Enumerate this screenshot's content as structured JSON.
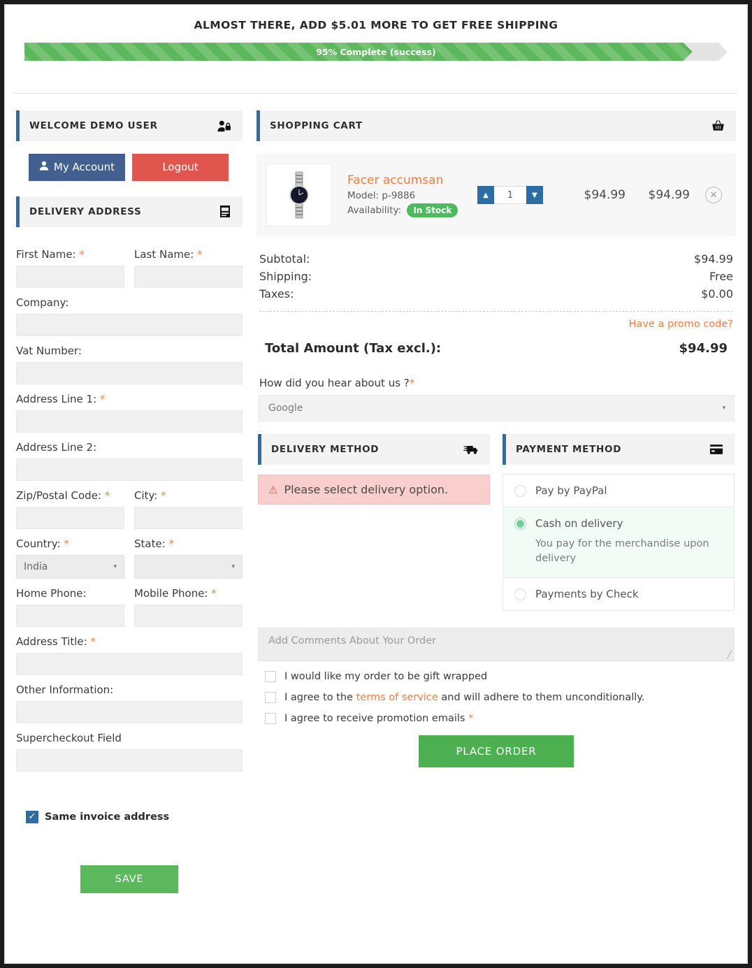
{
  "banner": {
    "title": "ALMOST THERE, ADD $5.01 MORE TO GET FREE SHIPPING",
    "progress_label": "95% Complete (success)",
    "progress_percent": 95,
    "fill_color": "#5cb85c",
    "track_color": "#e4e4e4"
  },
  "sidebar": {
    "welcome": {
      "title": "WELCOME DEMO USER",
      "icon": "user-lock-icon"
    },
    "account_button": "My Account",
    "logout_button": "Logout",
    "delivery_address": {
      "title": "DELIVERY ADDRESS",
      "icon": "address-card-icon"
    },
    "fields": {
      "first_name": {
        "label": "First Name:",
        "required": true,
        "value": ""
      },
      "last_name": {
        "label": "Last Name:",
        "required": true,
        "value": ""
      },
      "company": {
        "label": "Company:",
        "required": false,
        "value": ""
      },
      "vat_number": {
        "label": "Vat Number:",
        "required": false,
        "value": ""
      },
      "address1": {
        "label": "Address Line 1:",
        "required": true,
        "value": ""
      },
      "address2": {
        "label": "Address Line 2:",
        "required": false,
        "value": ""
      },
      "zip": {
        "label": "Zip/Postal Code:",
        "required": true,
        "value": ""
      },
      "city": {
        "label": "City:",
        "required": true,
        "value": ""
      },
      "country": {
        "label": "Country:",
        "required": true,
        "value": "India"
      },
      "state": {
        "label": "State:",
        "required": true,
        "value": ""
      },
      "home_phone": {
        "label": "Home Phone:",
        "required": false,
        "value": ""
      },
      "mobile_phone": {
        "label": "Mobile Phone:",
        "required": true,
        "value": ""
      },
      "address_title": {
        "label": "Address Title:",
        "required": true,
        "value": ""
      },
      "other_info": {
        "label": "Other Information:",
        "required": false,
        "value": ""
      },
      "supercheckout": {
        "label": "Supercheckout Field",
        "required": false,
        "value": ""
      }
    },
    "same_invoice": {
      "label": "Same invoice address",
      "checked": true,
      "check_glyph": "✓"
    },
    "save_button": "SAVE"
  },
  "cart": {
    "title": "SHOPPING CART",
    "icon": "shopping-basket-icon",
    "item": {
      "name": "Facer accumsan",
      "model_label": "Model:",
      "model": "p-9886",
      "availability_label": "Availability:",
      "availability": "In Stock",
      "quantity": "1",
      "unit_price": "$94.99",
      "total_price": "$94.99",
      "remove_glyph": "✕",
      "image": "wristwatch-thumbnail"
    },
    "totals": [
      {
        "label": "Subtotal:",
        "value": "$94.99"
      },
      {
        "label": "Shipping:",
        "value": "Free"
      },
      {
        "label": "Taxes:",
        "value": "$0.00"
      }
    ],
    "promo_link": "Have a promo code?",
    "total_label": "Total Amount (Tax excl.):",
    "total_value": "$94.99"
  },
  "hear_about": {
    "label": "How did you hear about us ?",
    "required": true,
    "selected": "Google",
    "caret": "▾"
  },
  "delivery_method": {
    "title": "DELIVERY METHOD",
    "icon": "shipping-truck-icon",
    "alert": "Please select delivery option.",
    "alert_icon": "exclamation-circle-icon"
  },
  "payment_method": {
    "title": "PAYMENT METHOD",
    "icon": "credit-card-icon",
    "options": [
      {
        "label": "Pay by PayPal",
        "selected": false,
        "description": ""
      },
      {
        "label": "Cash on delivery",
        "selected": true,
        "description": "You pay for the merchandise upon delivery"
      },
      {
        "label": "Payments by Check",
        "selected": false,
        "description": ""
      }
    ]
  },
  "comments": {
    "placeholder": "Add Comments About Your Order",
    "value": ""
  },
  "agreements": [
    {
      "text_before": "I would like my order to be gift wrapped",
      "link": "",
      "text_after": "",
      "required": false,
      "checked": false
    },
    {
      "text_before": "I agree to the ",
      "link": "terms of service",
      "text_after": " and will adhere to them unconditionally.",
      "required": false,
      "checked": false
    },
    {
      "text_before": "I agree to receive promotion emails ",
      "link": "",
      "text_after": "",
      "required": true,
      "checked": false
    }
  ],
  "place_order_button": "PLACE ORDER",
  "colors": {
    "accent_blue": "#2e6da4",
    "orange": "#f07c3f",
    "green": "#5cb85c",
    "red": "#e0564f"
  }
}
